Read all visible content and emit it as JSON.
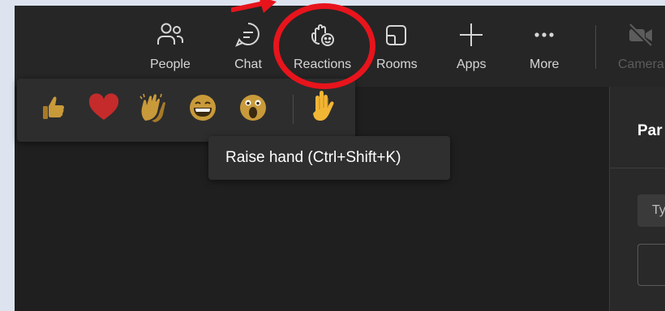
{
  "toolbar": {
    "people_label": "People",
    "chat_label": "Chat",
    "reactions_label": "Reactions",
    "rooms_label": "Rooms",
    "apps_label": "Apps",
    "more_label": "More",
    "camera_label": "Camera"
  },
  "reactions": {
    "items": [
      "like",
      "love",
      "applause",
      "laugh",
      "surprised"
    ],
    "raise_hand": "raise-hand"
  },
  "tooltip": {
    "text": "Raise hand (Ctrl+Shift+K)"
  },
  "side_panel": {
    "title": "Par",
    "search_placeholder": "Ty"
  },
  "annotation": {
    "color": "#e8141c"
  }
}
